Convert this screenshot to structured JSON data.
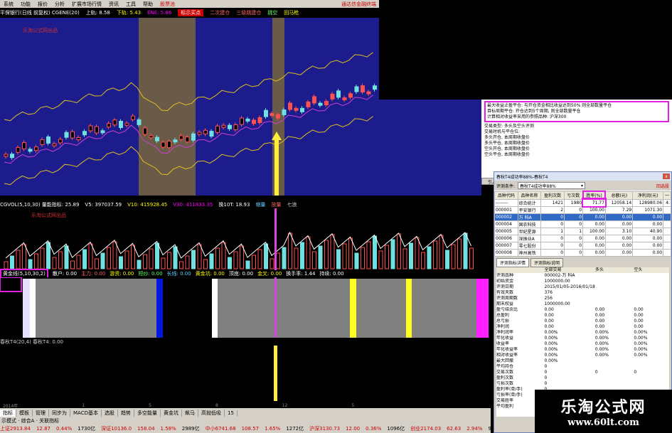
{
  "menubar": {
    "items": [
      "系统",
      "功能",
      "报价",
      "分析",
      "扩展市场行情",
      "资讯",
      "工具",
      "帮助",
      "股票池"
    ],
    "logo": "通达信金融终端"
  },
  "headline": {
    "items": [
      "平保银行(日线 前复权) CGENE(20)",
      "上轨: 8.58",
      "下轨: 5.43",
      "ENE: 5.86",
      "标示买点",
      "二次建仓",
      "三级跳建仓",
      "跳空",
      "回马枪"
    ]
  },
  "chart": {
    "watermark_text": "乐淘公式网出品",
    "colors": {
      "bg": "#1c1c8c",
      "band": "#f0c020",
      "mid": "#d040d0",
      "shade": "#6a5a48",
      "up": "#ff5050",
      "down": "#70e0e0",
      "arrow": "#ffee40"
    }
  },
  "sub_bar": {
    "items": [
      "CGVOL(5,10,30) 量能指标: 25.89",
      "V5: 397037.59",
      "V10: 415928.45",
      "V30: 411833.35",
      "换10T: 18.93",
      "缩量",
      "放量",
      "七浪"
    ]
  },
  "vol_panel": {
    "watermark_text": "乐淘公式网出品"
  },
  "ind_bar": {
    "items": [
      "黄金线(5,10,30,2)",
      "散户: 0.00",
      "主力: 0.00",
      "游资: 0.00",
      "短炒: 0.00",
      "长线: 0.00",
      "黄金坑: 0.00",
      "顶底: 0.00",
      "金叉: 0.00",
      "换手率: 1.44",
      "持续: 0.00"
    ]
  },
  "lower_bar": {
    "label": "春秋T4(20,4) 春秋T4: 0.00"
  },
  "timeline": {
    "labels": [
      "2014年",
      "1",
      "5",
      "8",
      "12",
      "5"
    ]
  },
  "bottom_tabs": {
    "items": [
      "指标",
      "模板",
      "管理",
      "同步为",
      "MACD基本",
      "选股",
      "趋势",
      "多空能量",
      "黄金坑",
      "飙马",
      "高抛低吸",
      "15"
    ]
  },
  "mid_strip": {
    "text": "示模式 · 综合A · 关联指标"
  },
  "status_bar": {
    "items": [
      {
        "text": "上证2913.84",
        "c": "rd"
      },
      {
        "text": "12.87",
        "c": "rd"
      },
      {
        "text": "0.44%",
        "c": "rd"
      },
      {
        "text": "1730亿",
        "c": ""
      },
      {
        "text": "深证10136.0",
        "c": "rd"
      },
      {
        "text": "158.04",
        "c": "rd"
      },
      {
        "text": "1.58%",
        "c": "rd"
      },
      {
        "text": "2989亿",
        "c": ""
      },
      {
        "text": "中小6741.68",
        "c": "rd"
      },
      {
        "text": "108.57",
        "c": "rd"
      },
      {
        "text": "1.65%",
        "c": "rd"
      },
      {
        "text": "1272亿",
        "c": ""
      },
      {
        "text": "沪深3130.73",
        "c": "rd"
      },
      {
        "text": "12.00",
        "c": "rd"
      },
      {
        "text": "0.36%",
        "c": "rd"
      },
      {
        "text": "1096亿",
        "c": ""
      },
      {
        "text": "创业2174.03",
        "c": "rd"
      },
      {
        "text": "62.63",
        "c": "rd"
      },
      {
        "text": "2.94%",
        "c": "rd"
      },
      {
        "text": "912.1亿",
        "c": ""
      },
      {
        "text": "数据同步傅主站",
        "c": ""
      }
    ]
  },
  "info_panel": {
    "lines": [
      "最大收益止盈平仓: 与开仓资金相比收益达到50% 则全部数量平仓",
      "目标周期平仓: 开仓达到5个周期, 则全部数量平仓",
      "计算相对收益率采用的参照品种: 沪深300",
      "",
      "交易类型: 多头及空头评测",
      "交易时机与平仓位:",
      "      多头开仓, 本周期收盘价",
      "      多头平仓, 本周期收盘价",
      "      空头开仓, 本周期收盘价",
      "      空头平仓, 本周期收盘价"
    ],
    "enter_button": "引入"
  },
  "dialog": {
    "title": "春秋T4成功率88%-春秋T4",
    "close": "x",
    "eval_label": "评测条件:",
    "eval_value": "春秋T4成功率88%",
    "link": "回选股",
    "headers": [
      "品种代码",
      "品种名称",
      "盈利次数",
      "亏次数",
      "胜率(%)",
      "总额(元)",
      "净利润(元)",
      "一"
    ],
    "rows": [
      {
        "code": "--------",
        "name": "综合统计",
        "win": "1421",
        "lose": "1980",
        "rate": "71.77",
        "total": "12058.14",
        "net": "128980.06",
        "x": "4.",
        "sel": false
      },
      {
        "code": "000001",
        "name": "平安银行",
        "win": "2",
        "lose": "0",
        "rate": "100.00",
        "total": "7.29",
        "net": "1071.30",
        "x": "",
        "sel": false
      },
      {
        "code": "000002",
        "name": "万 科A",
        "win": "0",
        "lose": "0",
        "rate": "0.00",
        "total": "0.00",
        "net": "0.00",
        "x": "",
        "sel": true
      },
      {
        "code": "000004",
        "name": "国农科技",
        "win": "0",
        "lose": "0",
        "rate": "0.00",
        "total": "0.00",
        "net": "0.00",
        "x": "",
        "sel": false
      },
      {
        "code": "000005",
        "name": "世纪星源",
        "win": "1",
        "lose": "1",
        "rate": "100.00",
        "total": "3.10",
        "net": "40.90",
        "x": "",
        "sel": false
      },
      {
        "code": "000006",
        "name": "深振业A",
        "win": "0",
        "lose": "0",
        "rate": "0.00",
        "total": "0.00",
        "net": "0.00",
        "x": "",
        "sel": false
      },
      {
        "code": "000007",
        "name": "零七股份",
        "win": "0",
        "lose": "0",
        "rate": "0.00",
        "total": "0.00",
        "net": "0.00",
        "x": "",
        "sel": false
      },
      {
        "code": "000008",
        "name": "神州高铁",
        "win": "0",
        "lose": "0",
        "rate": "0.00",
        "total": "0.00",
        "net": "0.00",
        "x": "",
        "sel": false
      }
    ],
    "tabs": [
      "评测指标详情",
      "评测指标说明"
    ],
    "detail_header": [
      "",
      "全部交易",
      "多头",
      "空头"
    ],
    "detail_rows": [
      [
        "评测品种",
        "000002-万 科A",
        "",
        ""
      ],
      [
        "初始资金",
        "1000000.00",
        "",
        ""
      ],
      [
        "评测日期",
        "2015/01/05-2016/01/18",
        "",
        ""
      ],
      [
        "有效天数",
        "376",
        "",
        ""
      ],
      [
        "评测周期数",
        "256",
        "",
        ""
      ],
      [
        "期末权益",
        "1000000.00",
        "",
        ""
      ],
      [
        "盈亏结余比",
        "0.00",
        "0.00",
        "0.00"
      ],
      [
        "总盈利",
        "0.00",
        "0.00",
        "0.00"
      ],
      [
        "总亏损",
        "0.00",
        "0.00",
        "0.00"
      ],
      [
        "净利润",
        "0.00",
        "0.00",
        "0.00"
      ],
      [
        "净利润率",
        "0.00%",
        "0.00%",
        "0.00%"
      ],
      [
        "年化收益",
        "0.00%",
        "0.00%",
        "0.00%"
      ],
      [
        "收益率",
        "0.00%",
        "0.00%",
        "0.00%"
      ],
      [
        "年化收益率",
        "0.00%",
        "0.00%",
        "0.00%"
      ],
      [
        "相对收益率",
        "0.00%",
        "0.00%",
        "0.00%"
      ],
      [
        "最大回撤",
        "0.00%",
        "",
        ""
      ],
      [
        "平均持仓",
        "0",
        "",
        ""
      ],
      [
        "交易次数",
        "0",
        "0",
        "0"
      ],
      [
        "盈利次数",
        "0",
        "",
        ""
      ],
      [
        "亏损次数",
        "0",
        "",
        ""
      ],
      [
        "盈利率(单/手)",
        "0",
        "",
        ""
      ],
      [
        "亏损率(单/手)",
        "0",
        "",
        ""
      ],
      [
        "交易胜率",
        "0.00%",
        "",
        ""
      ],
      [
        "平均盈利",
        "0.00",
        "",
        ""
      ]
    ]
  },
  "site_watermark": {
    "line1": "乐淘公式网",
    "line2": "www.60lt.com"
  }
}
